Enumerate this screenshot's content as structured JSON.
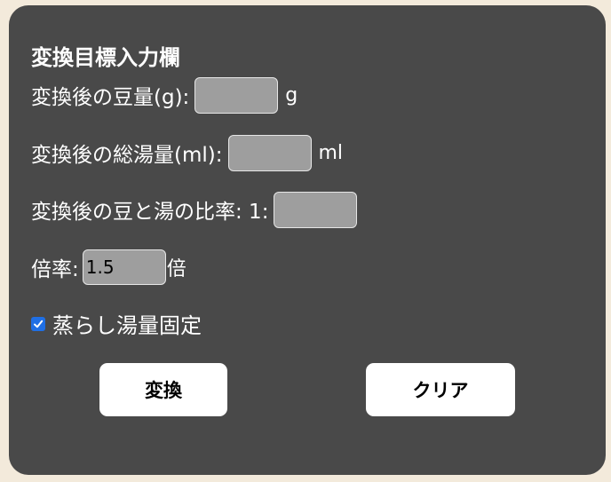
{
  "panel": {
    "title": "変換目標入力欄"
  },
  "fields": {
    "beans": {
      "label": "変換後の豆量(g):",
      "value": "",
      "unit": "g"
    },
    "water": {
      "label": "変換後の総湯量(ml):",
      "value": "",
      "unit": "ml"
    },
    "ratio": {
      "label": "変換後の豆と湯の比率: 1:",
      "value": ""
    },
    "multiplier": {
      "label": "倍率:",
      "value": "1.5",
      "unit": "倍"
    }
  },
  "checkbox": {
    "label": "蒸らし湯量固定",
    "checked": true
  },
  "buttons": {
    "convert": "変換",
    "clear": "クリア"
  },
  "colors": {
    "page_background": "#f3eadb",
    "panel_background": "#494949",
    "field_background": "#9e9e9e",
    "checkbox_accent": "#1f6fe5"
  }
}
